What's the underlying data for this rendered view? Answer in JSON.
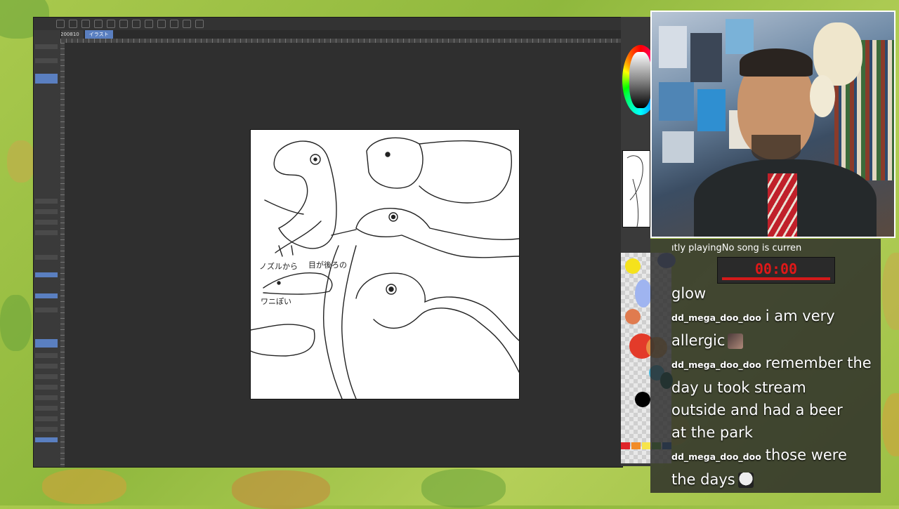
{
  "app": {
    "tabs": [
      "200810",
      "イラスト"
    ],
    "active_tab": 1,
    "left_panel_selected_rows": [
      3,
      8,
      12
    ]
  },
  "canvas": {
    "annotations": [
      "ノズルから",
      "目が後ろの",
      "ワニぽい"
    ]
  },
  "chat": {
    "now_playing": "ıtly playingNo song is curren",
    "timer": "00:00",
    "messages": [
      {
        "user": "",
        "lines": [
          "glow"
        ],
        "emote_after": null
      },
      {
        "user": "dd_mega_doo_doo",
        "lines": [
          "i am very",
          "allergic"
        ],
        "emote_after": "face-emote"
      },
      {
        "user": "dd_mega_doo_doo",
        "lines": [
          "remember the",
          "day u took stream",
          "outside and had a beer",
          "at the park"
        ],
        "emote_after": null
      },
      {
        "user": "dd_mega_doo_doo",
        "lines": [
          "those were",
          "the days"
        ],
        "emote_after": "cool-emote"
      }
    ]
  },
  "colors": {
    "accent": "#5a7fc0",
    "timer_red": "#e01818",
    "bg_green": "#a9c94d"
  },
  "palette_swatches": [
    "#f5e21c",
    "#6f86c8",
    "#9fb4f0",
    "#e07b4f",
    "#e33b2a",
    "#e7a34c",
    "#47b4d8",
    "#0b5f56",
    "#000000"
  ]
}
